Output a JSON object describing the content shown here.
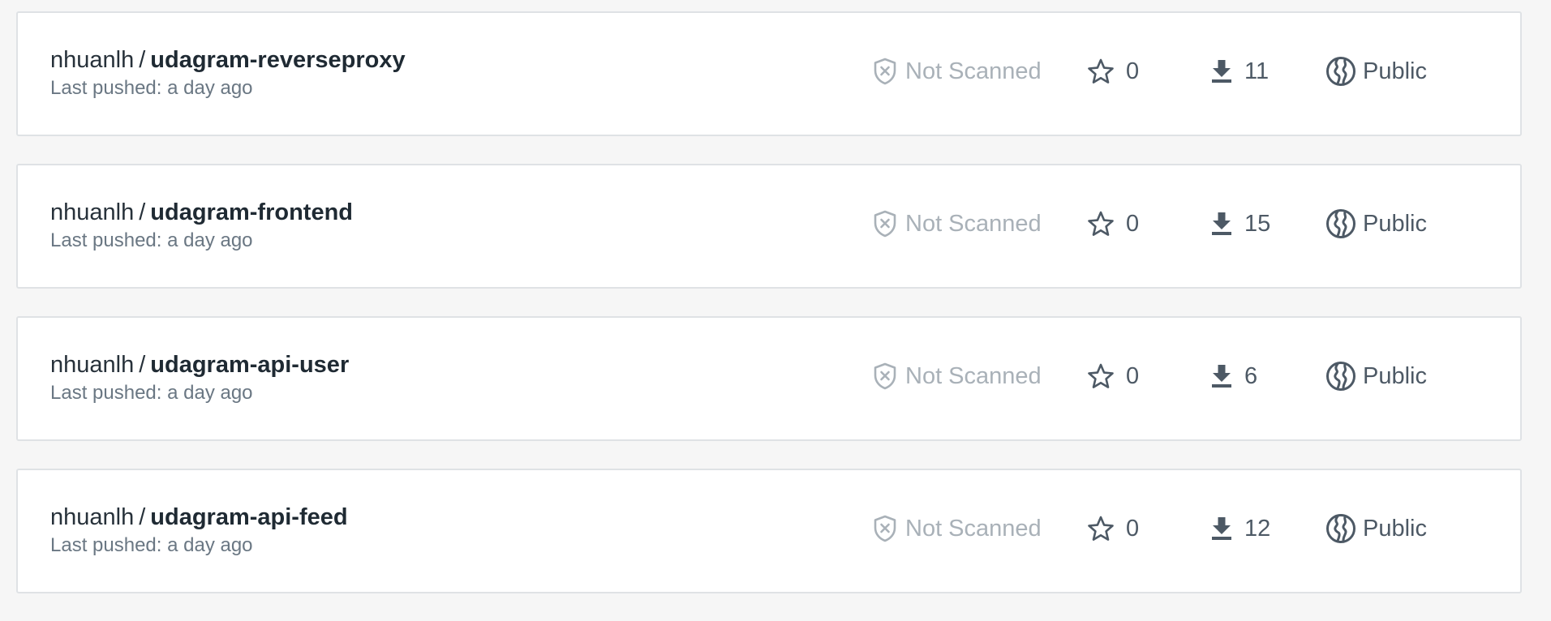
{
  "colors": {
    "background": "#f6f6f6",
    "card": "#ffffff",
    "card_border": "#dfe2e5",
    "text_primary": "#27313a",
    "text_secondary": "#6a7783",
    "muted": "#a9b1b8",
    "icon": "#4d5965"
  },
  "icons": {
    "scan": "shield-x-icon",
    "stars": "star-icon",
    "pulls": "download-icon",
    "visibility": "globe-icon"
  },
  "repos": [
    {
      "owner": "nhuanlh",
      "separator": "/",
      "name": "udagram-reverseproxy",
      "last_pushed": "Last pushed: a day ago",
      "scan_status": "Not Scanned",
      "stars": "0",
      "pulls": "11",
      "visibility": "Public"
    },
    {
      "owner": "nhuanlh",
      "separator": "/",
      "name": "udagram-frontend",
      "last_pushed": "Last pushed: a day ago",
      "scan_status": "Not Scanned",
      "stars": "0",
      "pulls": "15",
      "visibility": "Public"
    },
    {
      "owner": "nhuanlh",
      "separator": "/",
      "name": "udagram-api-user",
      "last_pushed": "Last pushed: a day ago",
      "scan_status": "Not Scanned",
      "stars": "0",
      "pulls": "6",
      "visibility": "Public"
    },
    {
      "owner": "nhuanlh",
      "separator": "/",
      "name": "udagram-api-feed",
      "last_pushed": "Last pushed: a day ago",
      "scan_status": "Not Scanned",
      "stars": "0",
      "pulls": "12",
      "visibility": "Public"
    }
  ]
}
